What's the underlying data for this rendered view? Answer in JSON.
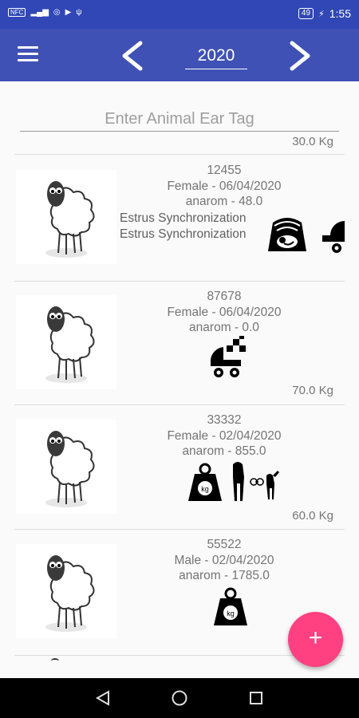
{
  "status": {
    "left_icons": [
      "nfc-icon",
      "signal-icon",
      "hotspot-icon",
      "youtube-icon",
      "usb-icon"
    ],
    "battery": "49",
    "time": "1:55"
  },
  "toolbar": {
    "year": "2020"
  },
  "search": {
    "placeholder": "Enter Animal Ear Tag"
  },
  "partial_top_weight": "30.0 Kg",
  "animals": [
    {
      "tag": "12455",
      "sex_date": "Female - 06/04/2020",
      "breed_value": "anarom - 48.0",
      "events": [
        "Estrus Synchronization",
        "Estrus Synchronization"
      ],
      "icons": [
        "ultrasound-pregnancy-icon",
        "stroller-icon"
      ],
      "weight": ""
    },
    {
      "tag": "87678",
      "sex_date": "Female - 06/04/2020",
      "breed_value": "anarom - 0.0",
      "events": [],
      "icons": [
        "stroller-icon"
      ],
      "weight": "70.0 Kg"
    },
    {
      "tag": "33332",
      "sex_date": "Female - 02/04/2020",
      "breed_value": "anarom - 855.0",
      "events": [],
      "icons": [
        "weight-kg-icon",
        "weaning-icon"
      ],
      "weight": "60.0 Kg"
    },
    {
      "tag": "55522",
      "sex_date": "Male - 02/04/2020",
      "breed_value": "anarom - 1785.0",
      "events": [],
      "icons": [
        "weight-kg-icon"
      ],
      "weight": ""
    }
  ],
  "fab": {
    "label": "+"
  },
  "colors": {
    "toolbar": "#3f51b5",
    "statusbar": "#3047b5",
    "fab": "#ff4081"
  }
}
